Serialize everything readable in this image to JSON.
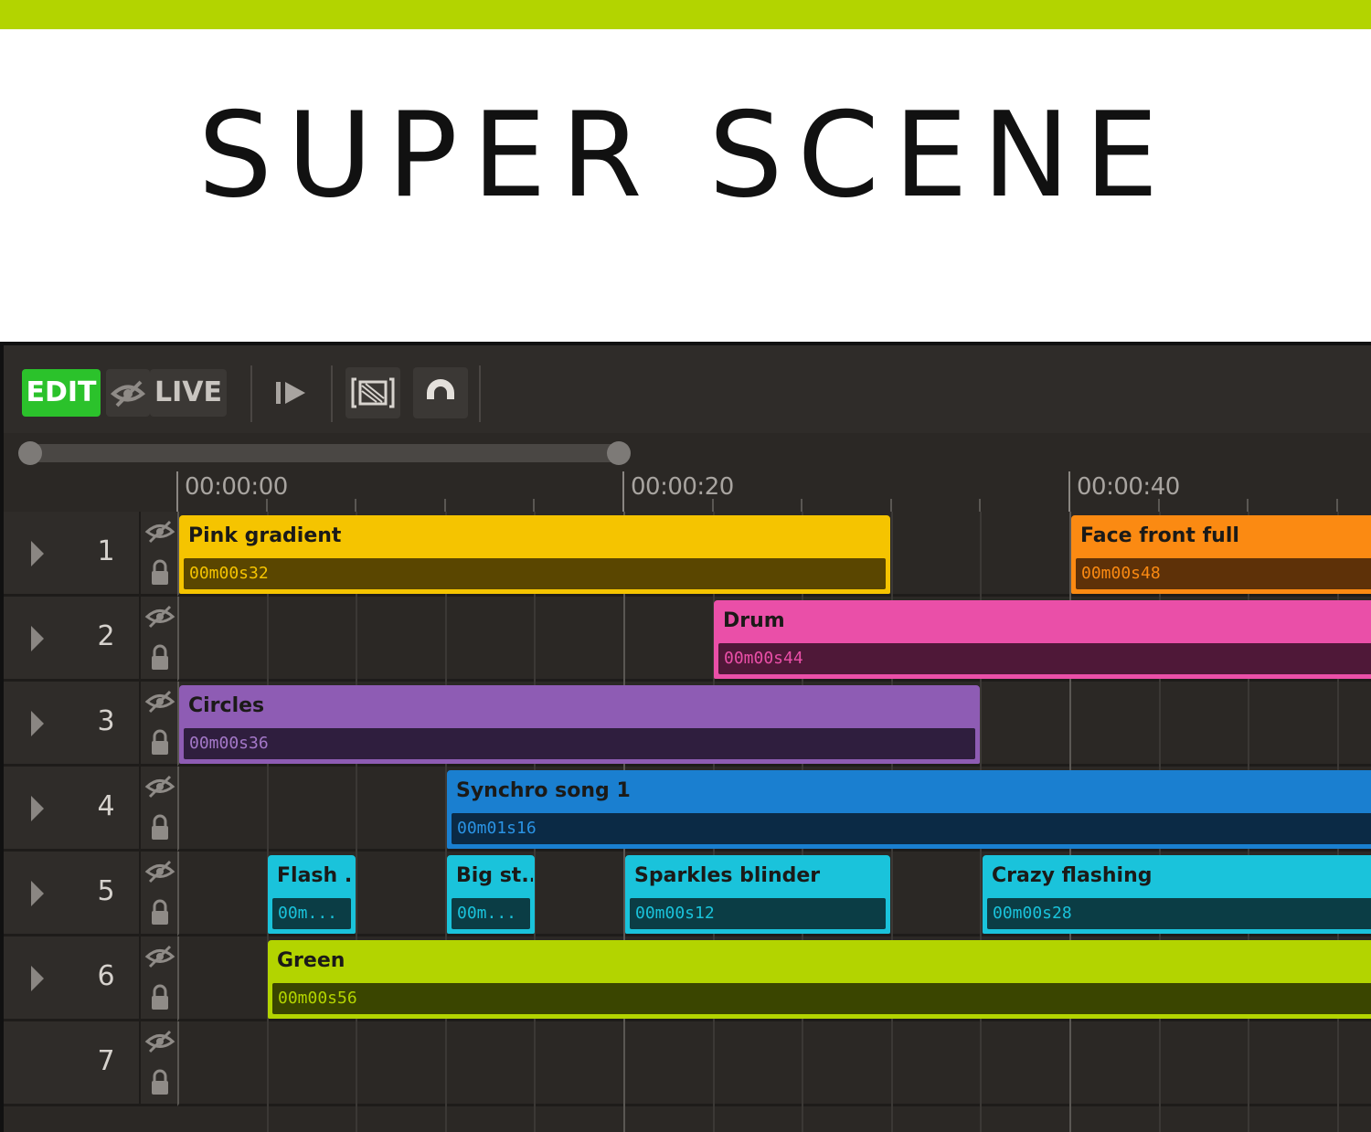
{
  "banner": {
    "title": "SUPER SCENE",
    "accent_color": "#b3d400"
  },
  "toolbar": {
    "edit_label": "EDIT",
    "edit_color": "#2bc22b",
    "live_label": "LIVE",
    "icons": [
      "hide-eye-icon",
      "play-step-icon",
      "fit-frame-icon",
      "magnet-icon"
    ]
  },
  "timeline": {
    "ruler": [
      "00:00:00",
      "00:00:20",
      "00:00:40"
    ]
  },
  "tracks": [
    {
      "number": "1"
    },
    {
      "number": "2"
    },
    {
      "number": "3"
    },
    {
      "number": "4"
    },
    {
      "number": "5"
    },
    {
      "number": "6"
    },
    {
      "number": "7"
    }
  ],
  "clips": [
    {
      "name": "Pink gradient",
      "duration": "00m00s32",
      "color": "#f5c400",
      "dur_bg": "#5a4600",
      "dur_fg": "#f5c400"
    },
    {
      "name": "Face front full",
      "duration": "00m00s48",
      "color": "#fb8a12",
      "dur_bg": "#5e3108",
      "dur_fg": "#fb8a12"
    },
    {
      "name": "Drum",
      "duration": "00m00s44",
      "color": "#ea4fa8",
      "dur_bg": "#4f1838",
      "dur_fg": "#ea4fa8"
    },
    {
      "name": "Circles",
      "duration": "00m00s36",
      "color": "#8e5cb4",
      "dur_bg": "#2f1e3e",
      "dur_fg": "#a478c8"
    },
    {
      "name": "Synchro song 1",
      "duration": "00m01s16",
      "color": "#1a7fd0",
      "dur_bg": "#0b2a45",
      "dur_fg": "#2a93e4"
    },
    {
      "name": "Flash ...",
      "duration": "00m...",
      "color": "#1ac3db",
      "dur_bg": "#0b3d45",
      "dur_fg": "#1ac3db"
    },
    {
      "name": "Big st...",
      "duration": "00m...",
      "color": "#1ac3db",
      "dur_bg": "#0b3d45",
      "dur_fg": "#1ac3db"
    },
    {
      "name": "Sparkles blinder",
      "duration": "00m00s12",
      "color": "#1ac3db",
      "dur_bg": "#0b3d45",
      "dur_fg": "#1ac3db"
    },
    {
      "name": "Crazy flashing",
      "duration": "00m00s28",
      "color": "#1ac3db",
      "dur_bg": "#0b3d45",
      "dur_fg": "#1ac3db"
    },
    {
      "name": "Green",
      "duration": "00m00s56",
      "color": "#b3d400",
      "dur_bg": "#3a4500",
      "dur_fg": "#b3d400"
    }
  ]
}
